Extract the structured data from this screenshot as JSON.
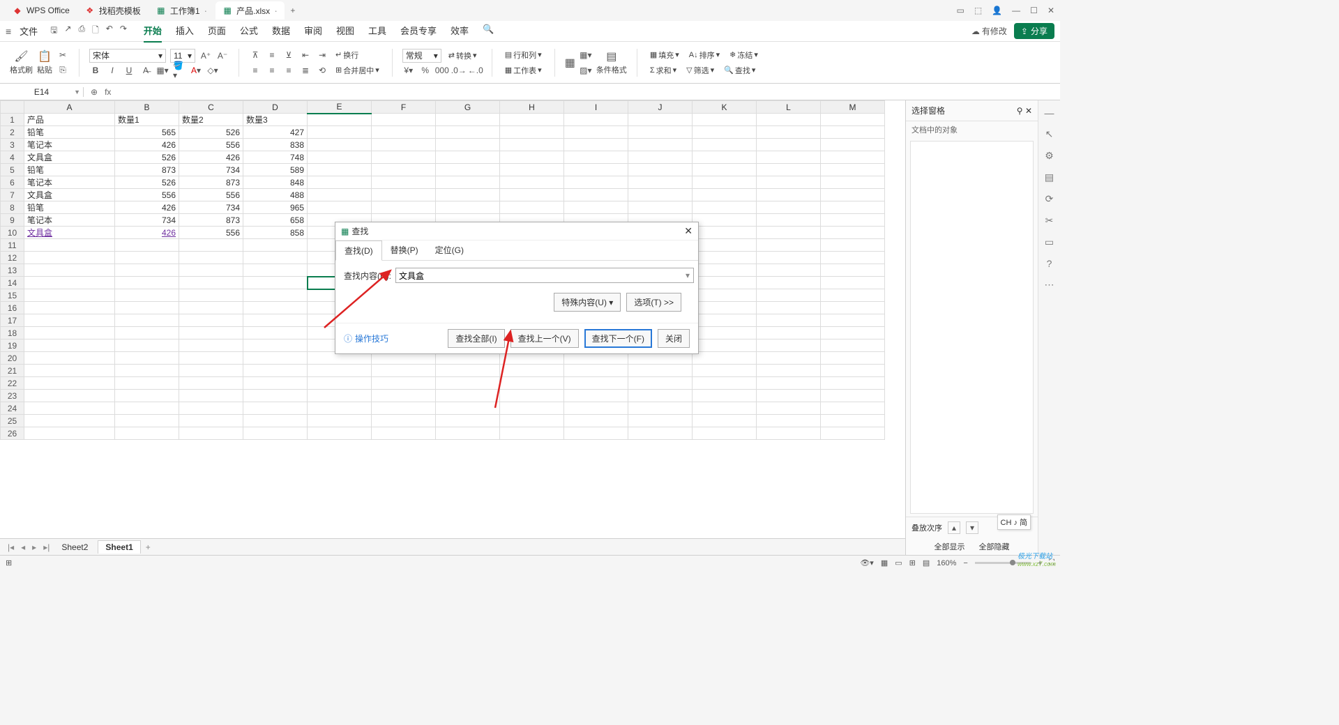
{
  "titlebar": {
    "apptab": "WPS Office",
    "tabs": [
      {
        "label": "找稻壳模板",
        "kind": "rice"
      },
      {
        "label": "工作簿1",
        "kind": "sheet"
      },
      {
        "label": "产品.xlsx",
        "kind": "sheet",
        "active": true
      }
    ],
    "newtab": "+"
  },
  "menubar": {
    "file": "文件",
    "tabs": [
      "开始",
      "插入",
      "页面",
      "公式",
      "数据",
      "审阅",
      "视图",
      "工具",
      "会员专享",
      "效率"
    ],
    "active": "开始",
    "status": "有修改",
    "share": "分享"
  },
  "ribbon": {
    "fmtbrush": "格式刷",
    "paste": "粘贴",
    "font": "宋体",
    "fontsize": "11",
    "wrap": "换行",
    "merge": "合并居中",
    "numfmt": "常规",
    "convert": "转换",
    "rowscols": "行和列",
    "worksheet": "工作表",
    "condfmt": "条件格式",
    "fill": "填充",
    "sort": "排序",
    "freeze": "冻结",
    "sum": "求和",
    "filter": "筛选",
    "find": "查找"
  },
  "formulabar": {
    "cellref": "E14",
    "fx": "fx"
  },
  "columns": [
    "A",
    "B",
    "C",
    "D",
    "E",
    "F",
    "G",
    "H",
    "I",
    "J",
    "K",
    "L",
    "M"
  ],
  "headers": {
    "A": "产品",
    "B": "数量1",
    "C": "数量2",
    "D": "数量3"
  },
  "rows": [
    {
      "A": "铅笔",
      "B": 565,
      "C": 526,
      "D": 427
    },
    {
      "A": "笔记本",
      "B": 426,
      "C": 556,
      "D": 838
    },
    {
      "A": "文具盒",
      "B": 526,
      "C": 426,
      "D": 748
    },
    {
      "A": "铅笔",
      "B": 873,
      "C": 734,
      "D": 589
    },
    {
      "A": "笔记本",
      "B": 526,
      "C": 873,
      "D": 848
    },
    {
      "A": "文具盒",
      "B": 556,
      "C": 556,
      "D": 488
    },
    {
      "A": "铅笔",
      "B": 426,
      "C": 734,
      "D": 965
    },
    {
      "A": "笔记本",
      "B": 734,
      "C": 873,
      "D": 658
    },
    {
      "A": "文具盒",
      "B": 426,
      "C": 556,
      "D": 858,
      "link": true
    }
  ],
  "totalrows": 26,
  "dialog": {
    "title": "查找",
    "tabs": [
      "查找(D)",
      "替换(P)",
      "定位(G)"
    ],
    "active_tab": "查找(D)",
    "content_label": "查找内容(N):",
    "content_value": "文具盒",
    "special": "特殊内容(U)",
    "options": "选项(T) >>",
    "tip": "操作技巧",
    "find_all": "查找全部(I)",
    "find_prev": "查找上一个(V)",
    "find_next": "查找下一个(F)",
    "close": "关闭"
  },
  "sidepanel": {
    "title": "选择窗格",
    "subtitle": "文档中的对象",
    "stack": "叠放次序",
    "showall": "全部显示",
    "hideall": "全部隐藏"
  },
  "sheets": {
    "items": [
      "Sheet2",
      "Sheet1"
    ],
    "active": "Sheet1"
  },
  "statusbar": {
    "zoom": "160%"
  },
  "ime": "CH ♪ 简",
  "watermark": {
    "line1": "极光下载站",
    "line2": "www.xz7.com"
  }
}
